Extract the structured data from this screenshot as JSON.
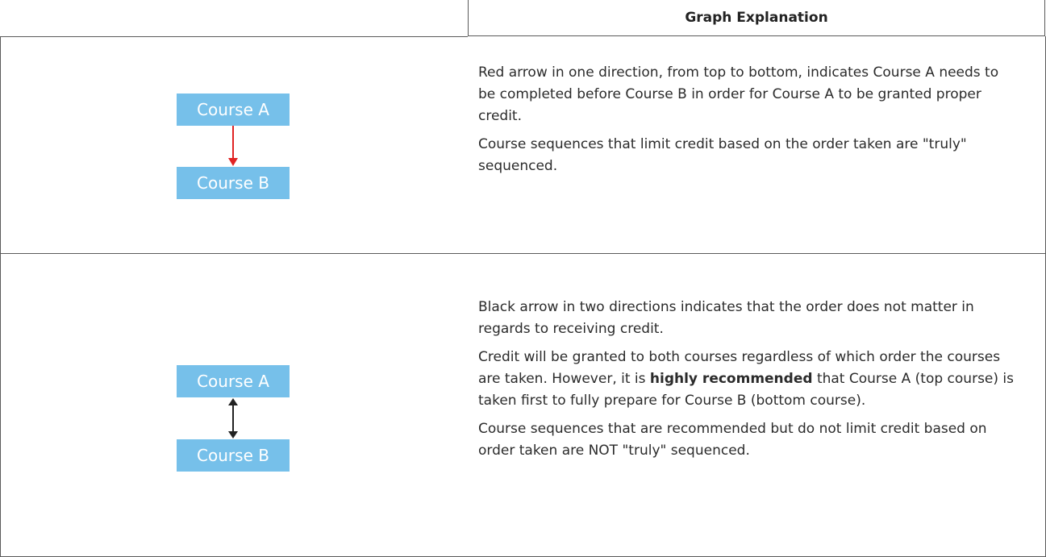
{
  "header": {
    "title": "Graph Explanation"
  },
  "rows": [
    {
      "course_top": "Course A",
      "course_bottom": "Course B",
      "arrow": {
        "type": "one-direction",
        "color": "#e02424",
        "icon": "arrow-down-icon"
      },
      "paragraphs": [
        "Red arrow in one direction, from top to bottom, indicates Course A needs to be completed before Course B in order for Course A to be granted proper credit.",
        "Course sequences that limit credit based on the order taken are \"truly\" sequenced."
      ]
    },
    {
      "course_top": "Course A",
      "course_bottom": "Course B",
      "arrow": {
        "type": "two-direction",
        "color": "#222222",
        "icon": "arrow-up-down-icon"
      },
      "paragraphs": [
        "Black arrow in two directions indicates that the order does not matter in regards to receiving credit.",
        "Course sequences that are recommended but do not limit credit based on order taken are NOT \"truly\" sequenced."
      ],
      "mixed_paragraph": {
        "before": "Credit will be granted to both courses regardless of which order the courses are taken. However, it is ",
        "bold": "highly recommended",
        "after": " that Course A (top course) is taken first to fully prepare for Course B (bottom course)."
      }
    }
  ],
  "colors": {
    "course_box": "#76c0ea",
    "border": "#5a5a5a"
  }
}
